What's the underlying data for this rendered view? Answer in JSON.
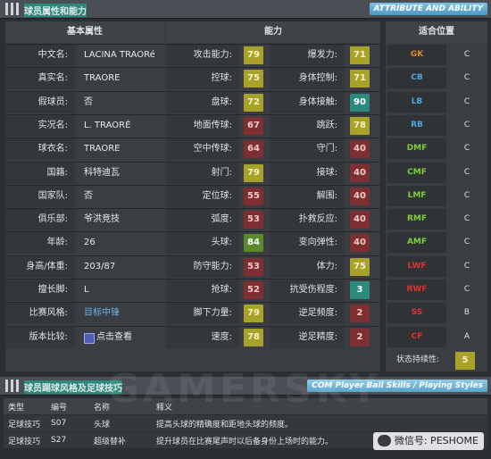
{
  "header": {
    "title": "球员属性和能力",
    "badge": "ATTRIBUTE AND ABILITY"
  },
  "basic": {
    "heading": "基本属性",
    "rows": [
      {
        "label": "中文名:",
        "value": "LACINA TRAORé"
      },
      {
        "label": "真实名:",
        "value": "TRAORE"
      },
      {
        "label": "假球员:",
        "value": "否"
      },
      {
        "label": "实况名:",
        "value": "L. TRAORÉ"
      },
      {
        "label": "球衣名:",
        "value": "TRAORE"
      },
      {
        "label": "国籍:",
        "value": "科特迪瓦"
      },
      {
        "label": "国家队:",
        "value": "否"
      },
      {
        "label": "俱乐部:",
        "value": "爷洪竞技"
      },
      {
        "label": "年龄:",
        "value": "26"
      },
      {
        "label": "身高/体重:",
        "value": "203/87"
      },
      {
        "label": "擅长脚:",
        "value": "L"
      },
      {
        "label": "比赛风格:",
        "value": "目标中锋"
      },
      {
        "label": "版本比较:",
        "value": "点击查看"
      }
    ]
  },
  "ability": {
    "heading": "能力",
    "rows": [
      {
        "l1": "攻击能力:",
        "v1": "79",
        "c1": "y",
        "l2": "爆发力:",
        "v2": "71",
        "c2": "y"
      },
      {
        "l1": "控球:",
        "v1": "75",
        "c1": "y",
        "l2": "身体控制:",
        "v2": "71",
        "c2": "y"
      },
      {
        "l1": "盘球:",
        "v1": "72",
        "c1": "y",
        "l2": "身体接触:",
        "v2": "90",
        "c2": "t"
      },
      {
        "l1": "地面传球:",
        "v1": "67",
        "c1": "r",
        "l2": "跳跃:",
        "v2": "78",
        "c2": "y"
      },
      {
        "l1": "空中传球:",
        "v1": "64",
        "c1": "r",
        "l2": "守门:",
        "v2": "40",
        "c2": "r"
      },
      {
        "l1": "射门:",
        "v1": "79",
        "c1": "y",
        "l2": "接球:",
        "v2": "40",
        "c2": "r"
      },
      {
        "l1": "定位球:",
        "v1": "55",
        "c1": "r",
        "l2": "解围:",
        "v2": "40",
        "c2": "r"
      },
      {
        "l1": "弧度:",
        "v1": "53",
        "c1": "r",
        "l2": "扑救反应:",
        "v2": "40",
        "c2": "r"
      },
      {
        "l1": "头球:",
        "v1": "84",
        "c1": "g",
        "l2": "变向弹性:",
        "v2": "40",
        "c2": "r"
      },
      {
        "l1": "防守能力:",
        "v1": "53",
        "c1": "r",
        "l2": "体力:",
        "v2": "75",
        "c2": "y"
      },
      {
        "l1": "抢球:",
        "v1": "52",
        "c1": "r",
        "l2": "抗受伤程度:",
        "v2": "3",
        "c2": "t"
      },
      {
        "l1": "脚下力量:",
        "v1": "79",
        "c1": "y",
        "l2": "逆足频度:",
        "v2": "2",
        "c2": "r"
      },
      {
        "l1": "速度:",
        "v1": "78",
        "c1": "y",
        "l2": "逆足精度:",
        "v2": "2",
        "c2": "r"
      }
    ]
  },
  "positions": {
    "heading": "适合位置",
    "rows": [
      {
        "pos": "GK",
        "rating": "C",
        "color": "#e08a2a"
      },
      {
        "pos": "CB",
        "rating": "C",
        "color": "#4fa8d8"
      },
      {
        "pos": "LB",
        "rating": "C",
        "color": "#4fa8d8"
      },
      {
        "pos": "RB",
        "rating": "C",
        "color": "#4fa8d8"
      },
      {
        "pos": "DMF",
        "rating": "C",
        "color": "#7ccf3a"
      },
      {
        "pos": "CMF",
        "rating": "C",
        "color": "#7ccf3a"
      },
      {
        "pos": "LMF",
        "rating": "C",
        "color": "#7ccf3a"
      },
      {
        "pos": "RMF",
        "rating": "C",
        "color": "#7ccf3a"
      },
      {
        "pos": "AMF",
        "rating": "C",
        "color": "#7ccf3a"
      },
      {
        "pos": "LWF",
        "rating": "C",
        "color": "#e0322e"
      },
      {
        "pos": "RWF",
        "rating": "C",
        "color": "#e0322e"
      },
      {
        "pos": "SS",
        "rating": "B",
        "color": "#e0322e"
      },
      {
        "pos": "CF",
        "rating": "A",
        "color": "#e0322e"
      }
    ],
    "form_label": "状态持续性:",
    "form_value": "5"
  },
  "skills_header": {
    "title": "球员踢球风格及足球技巧",
    "badge": "COM Player Ball Skills / Playing Styles"
  },
  "skills": {
    "columns": [
      "类型",
      "编号",
      "名称",
      "释义"
    ],
    "rows": [
      {
        "type": "足球技巧",
        "code": "S07",
        "name": "头球",
        "desc": "提高头球的精确度和距地头球的频度。"
      },
      {
        "type": "足球技巧",
        "code": "S27",
        "name": "超级替补",
        "desc": "提升球员在比赛尾声时以后备身份上场时的能力。"
      }
    ]
  },
  "watermark": "GAMERSKY",
  "wechat": "微信号: PESHOME"
}
